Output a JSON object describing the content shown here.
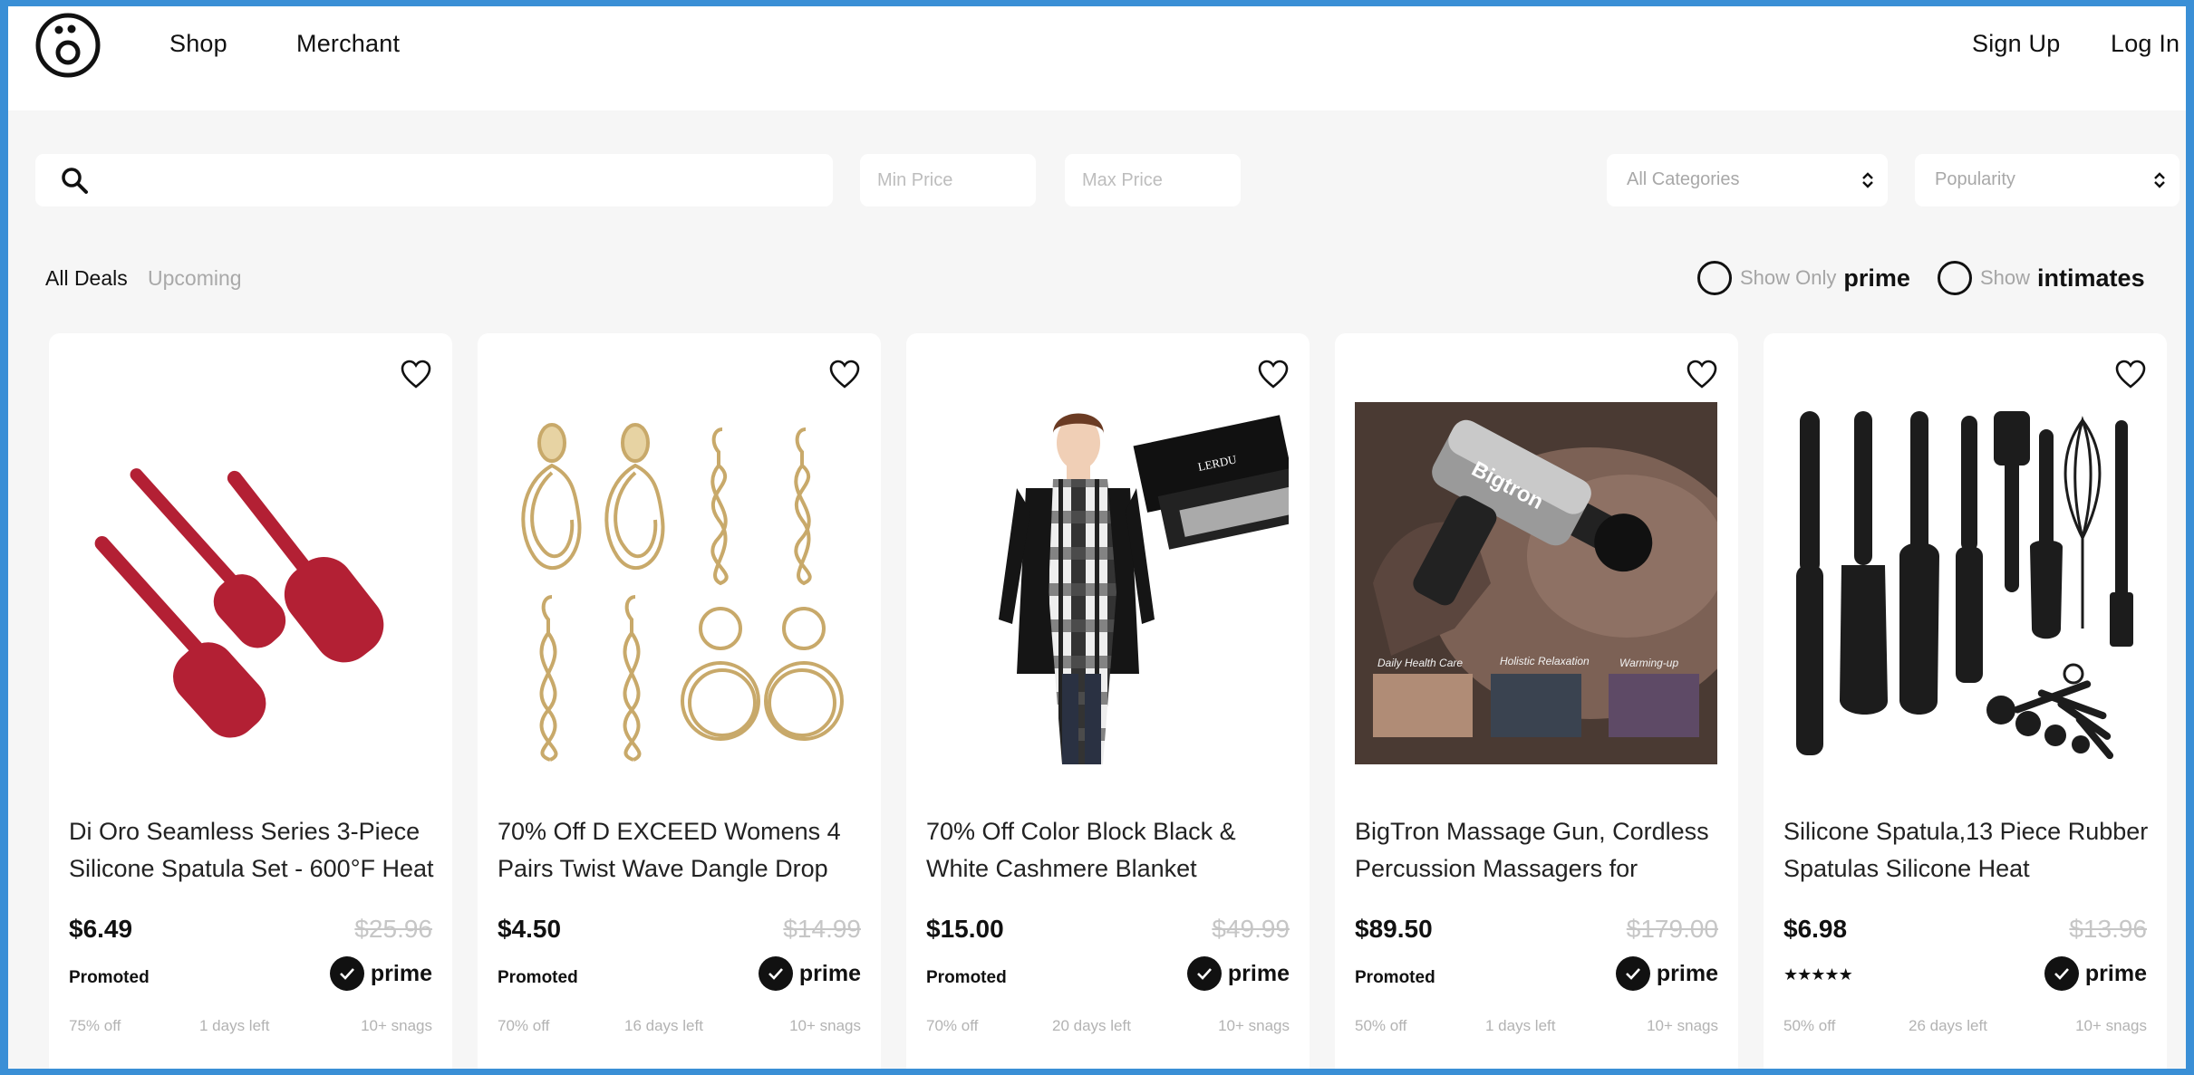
{
  "header": {
    "nav": [
      "Shop",
      "Merchant"
    ],
    "sign_up": "Sign Up",
    "log_in": "Log In"
  },
  "filters": {
    "search_placeholder": "",
    "min_price_placeholder": "Min Price",
    "max_price_placeholder": "Max Price",
    "category_value": "All Categories",
    "sort_value": "Popularity"
  },
  "tabs": {
    "all": "All Deals",
    "upcoming": "Upcoming"
  },
  "toggles": {
    "prime_prefix": "Show Only",
    "prime_word": "prime",
    "intimates_prefix": "Show",
    "intimates_word": "intimates"
  },
  "prime_label": "prime",
  "products": [
    {
      "title": "Di Oro Seamless Series 3-Piece Silicone Spatula Set - 600°F Heat",
      "price": "$6.49",
      "old_price": "$25.96",
      "badge": "Promoted",
      "discount": "75% off",
      "days_left": "1 days left",
      "snags": "10+ snags"
    },
    {
      "title": "70% Off D EXCEED Womens 4 Pairs Twist Wave Dangle Drop",
      "price": "$4.50",
      "old_price": "$14.99",
      "badge": "Promoted",
      "discount": "70% off",
      "days_left": "16 days left",
      "snags": "10+ snags"
    },
    {
      "title": "70% Off Color Block Black & White Cashmere Blanket",
      "price": "$15.00",
      "old_price": "$49.99",
      "badge": "Promoted",
      "discount": "70% off",
      "days_left": "20 days left",
      "snags": "10+ snags",
      "image_text": "LERDU"
    },
    {
      "title": "BigTron Massage Gun, Cordless Percussion Massagers for",
      "price": "$89.50",
      "old_price": "$179.00",
      "badge": "Promoted",
      "discount": "50% off",
      "days_left": "1 days left",
      "snags": "10+ snags",
      "image_text": {
        "brand": "Bigtron",
        "captions": [
          "Daily Health Care",
          "Holistic Relaxation",
          "Warming-up"
        ]
      }
    },
    {
      "title": "Silicone Spatula,13 Piece Rubber Spatulas Silicone Heat",
      "price": "$6.98",
      "old_price": "$13.96",
      "rating_stars": 5,
      "discount": "50% off",
      "days_left": "26 days left",
      "snags": "10+ snags"
    }
  ]
}
